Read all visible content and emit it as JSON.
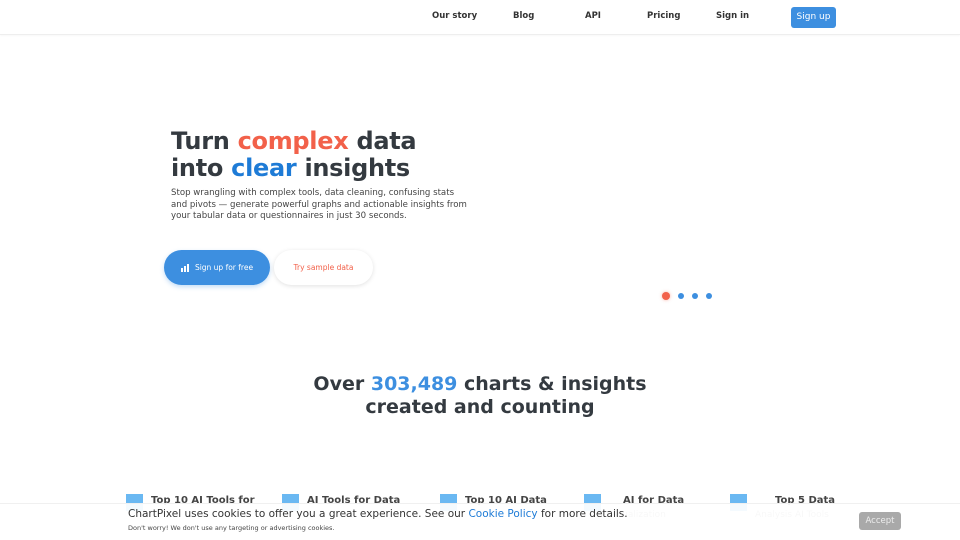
{
  "nav": {
    "items": [
      "Our story",
      "Blog",
      "API",
      "Pricing",
      "Sign in"
    ],
    "signup_label": "Sign up"
  },
  "hero": {
    "title_line1_a": "Turn ",
    "title_line1_b": "complex",
    "title_line1_c": " data",
    "title_line2_a": "into ",
    "title_line2_b": "clear",
    "title_line2_c": " insights",
    "subtitle": "Stop wrangling with complex tools, data cleaning, confusing stats and pivots — generate powerful graphs and actionable insights from your tabular data or questionnaires in just 30 seconds.",
    "primary_cta": "Sign up for free",
    "secondary_cta": "Try sample data",
    "carousel": {
      "total": 4,
      "active_index": 0
    }
  },
  "counter": {
    "prefix": "Over ",
    "number": "303,489",
    "suffix": " charts & insights",
    "line2": "created and counting"
  },
  "cards": [
    {
      "title": "Top 10 AI Tools for",
      "subtitle": ""
    },
    {
      "title": "AI Tools for Data",
      "subtitle": ""
    },
    {
      "title": "Top 10 AI Data",
      "subtitle": ""
    },
    {
      "title": "AI for Data",
      "subtitle": "Visualization"
    },
    {
      "title": "Top 5 Data",
      "subtitle": "Analysis AI Tools"
    }
  ],
  "cookie": {
    "text_before": "ChartPixel uses cookies to offer you a great experience. See our ",
    "link": "Cookie Policy",
    "text_after": " for more details.",
    "note": "Don't worry! We don't use any targeting or advertising cookies.",
    "accept_label": "Accept"
  },
  "colors": {
    "accent_blue": "#3d8fe0",
    "accent_orange": "#f2614a",
    "heading": "#343a40"
  }
}
